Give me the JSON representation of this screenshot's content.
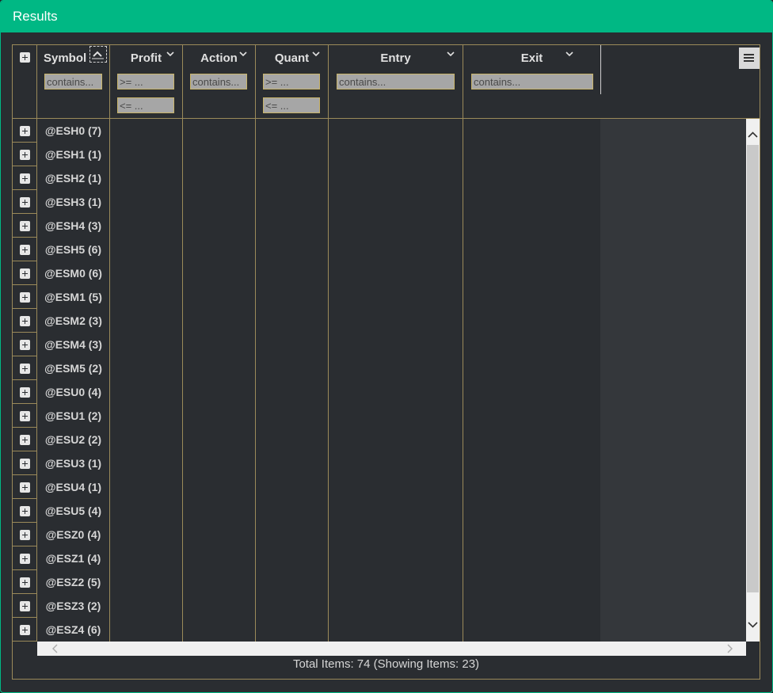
{
  "window": {
    "title": "Results"
  },
  "columns": [
    {
      "label": "Symbol",
      "filters": [
        "contains..."
      ]
    },
    {
      "label": "Profit",
      "filters": [
        ">= ...",
        "<= ..."
      ]
    },
    {
      "label": "Action",
      "filters": [
        "contains..."
      ]
    },
    {
      "label": "Quant",
      "filters": [
        ">= ...",
        "<= ..."
      ]
    },
    {
      "label": "Entry",
      "filters": [
        "contains..."
      ]
    },
    {
      "label": "Exit",
      "filters": [
        "contains..."
      ]
    }
  ],
  "rows": [
    "@ESH0 (7)",
    "@ESH1 (1)",
    "@ESH2 (1)",
    "@ESH3 (1)",
    "@ESH4 (3)",
    "@ESH5 (6)",
    "@ESM0 (6)",
    "@ESM1 (5)",
    "@ESM2 (3)",
    "@ESM4 (3)",
    "@ESM5 (2)",
    "@ESU0 (4)",
    "@ESU1 (2)",
    "@ESU2 (2)",
    "@ESU3 (1)",
    "@ESU4 (1)",
    "@ESU5 (4)",
    "@ESZ0 (4)",
    "@ESZ1 (4)",
    "@ESZ2 (5)",
    "@ESZ3 (2)",
    "@ESZ4 (6)"
  ],
  "footer": {
    "status": "Total Items: 74 (Showing Items: 23)"
  },
  "icons": {
    "expand": "plus-box-icon",
    "column_menu": "chevron-down-icon",
    "grid_menu": "hamburger-menu-icon",
    "sort": "sort-ascending-icon"
  },
  "colors": {
    "accent": "#00b884",
    "border": "#9b8a5a",
    "background": "#2a2d31"
  }
}
